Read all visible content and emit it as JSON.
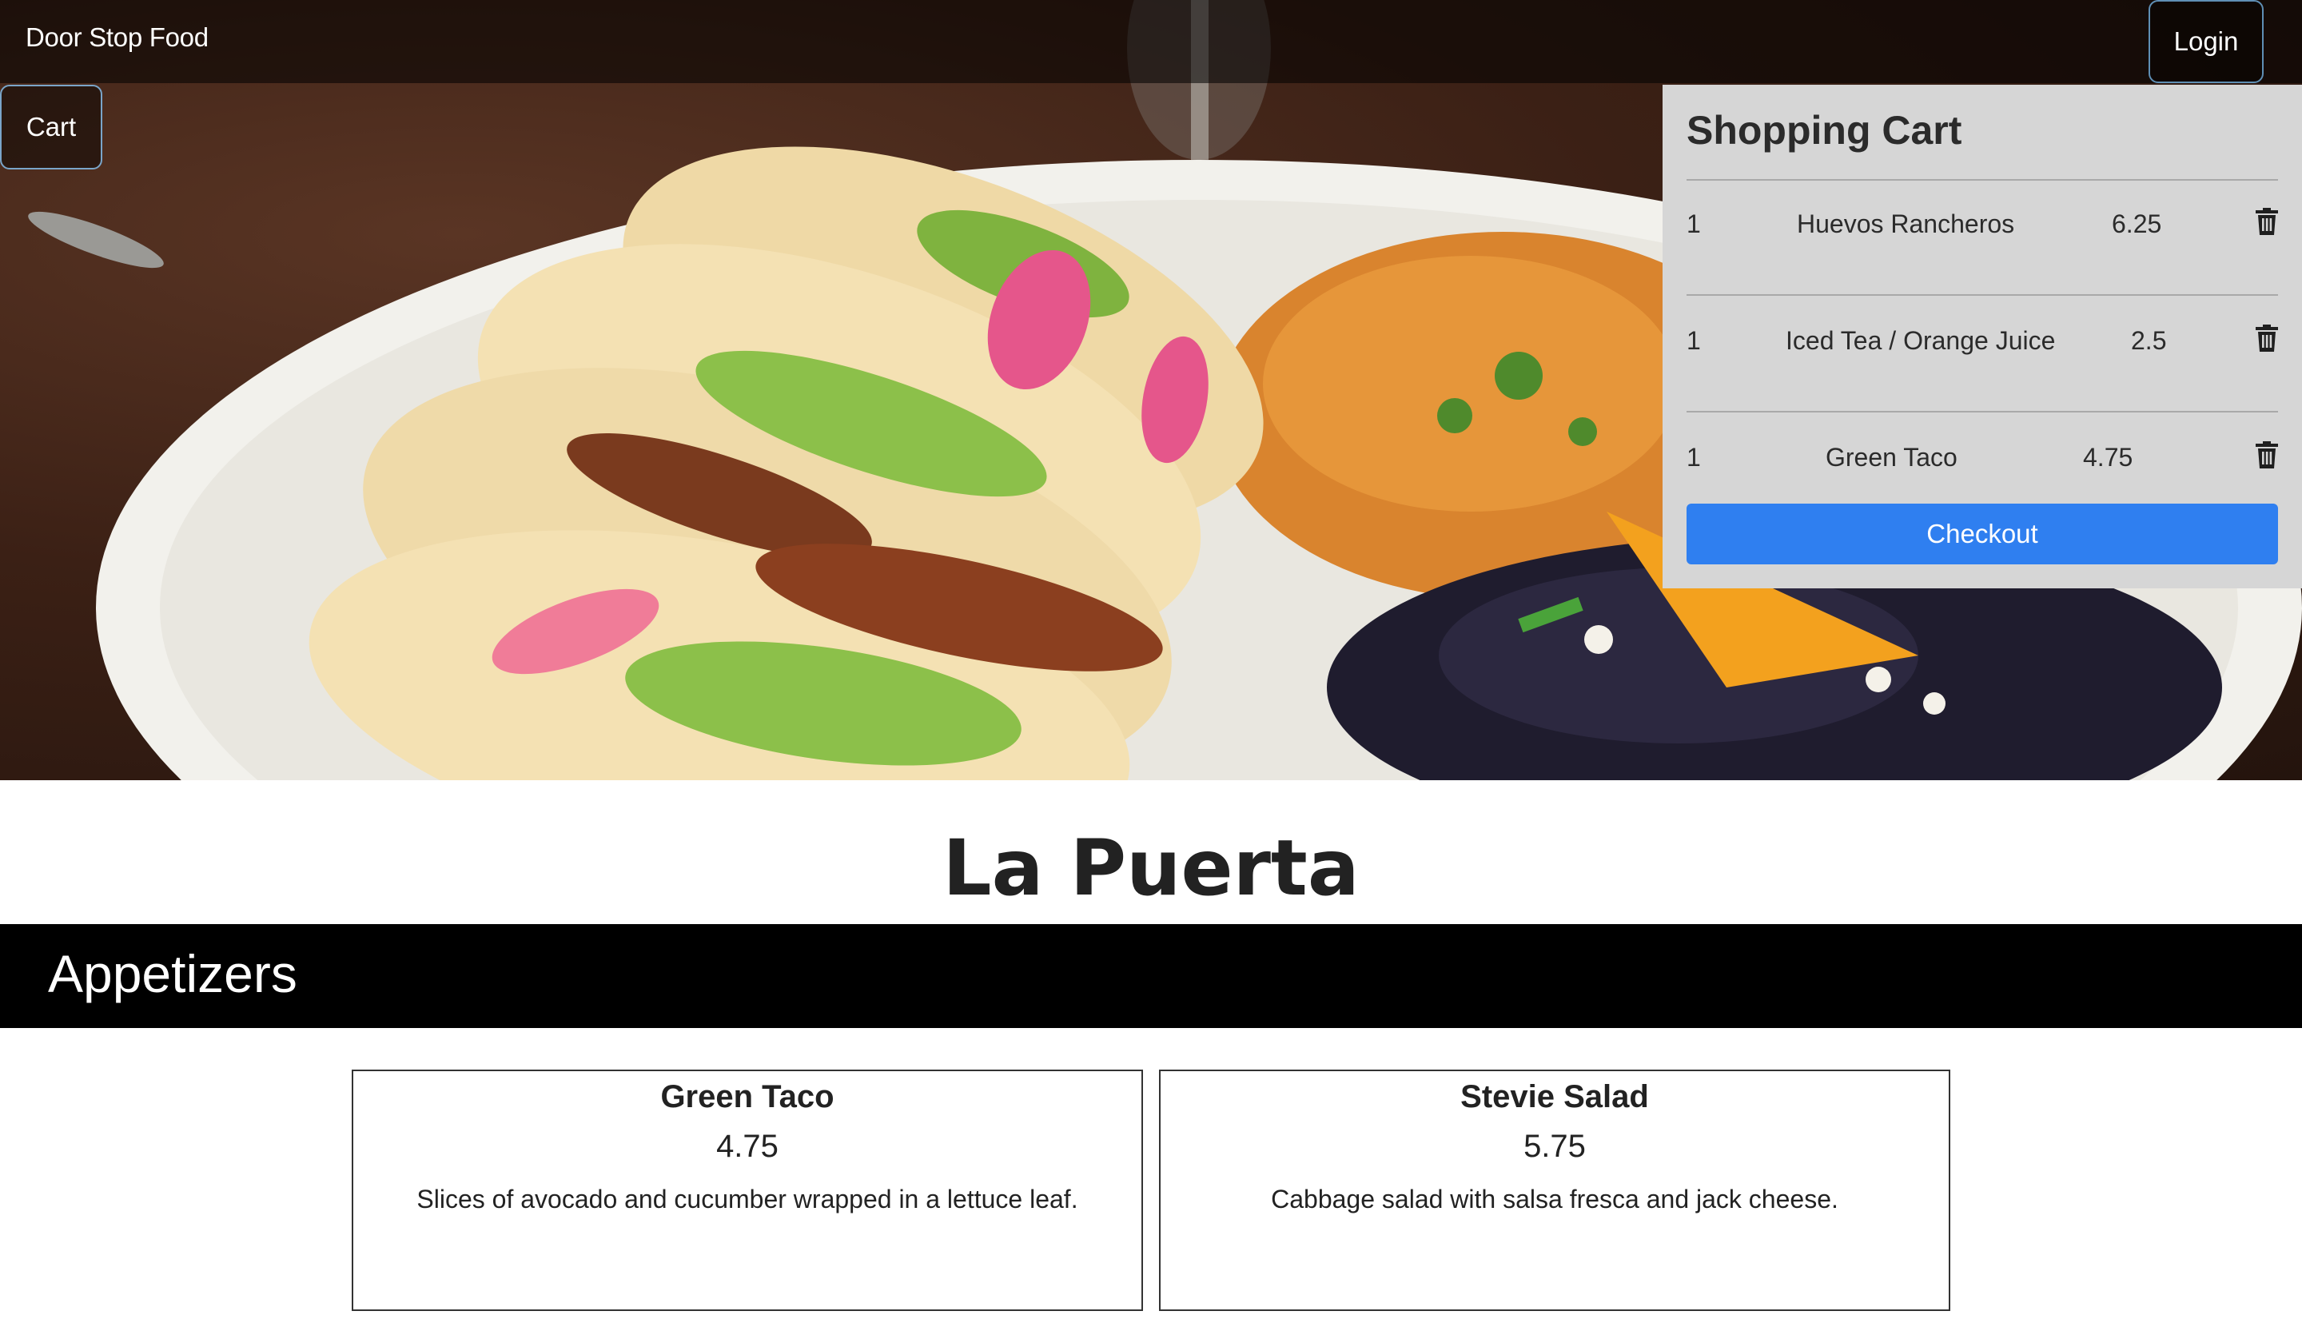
{
  "navbar": {
    "brand": "Door Stop Food",
    "login_label": "Login",
    "cart_label": "Cart"
  },
  "cart": {
    "title": "Shopping Cart",
    "items": [
      {
        "qty": "1",
        "name": "Huevos Rancheros",
        "price": "6.25"
      },
      {
        "qty": "1",
        "name": "Iced Tea / Orange Juice",
        "price": "2.5"
      },
      {
        "qty": "1",
        "name": "Green Taco",
        "price": "4.75"
      }
    ],
    "checkout_label": "Checkout",
    "trash_icon": "trash-icon"
  },
  "restaurant": {
    "name": "La Puerta"
  },
  "section": {
    "title": "Appetizers"
  },
  "menu_items": [
    {
      "name": "Green Taco",
      "price": "4.75",
      "description": "Slices of avocado and cucumber wrapped in a lettuce leaf."
    },
    {
      "name": "Stevie Salad",
      "price": "5.75",
      "description": "Cabbage salad with salsa fresca and jack cheese."
    }
  ],
  "colors": {
    "checkout": "#2f7ff0",
    "section_band": "#000000",
    "cart_panel": "#d6d6d6"
  }
}
